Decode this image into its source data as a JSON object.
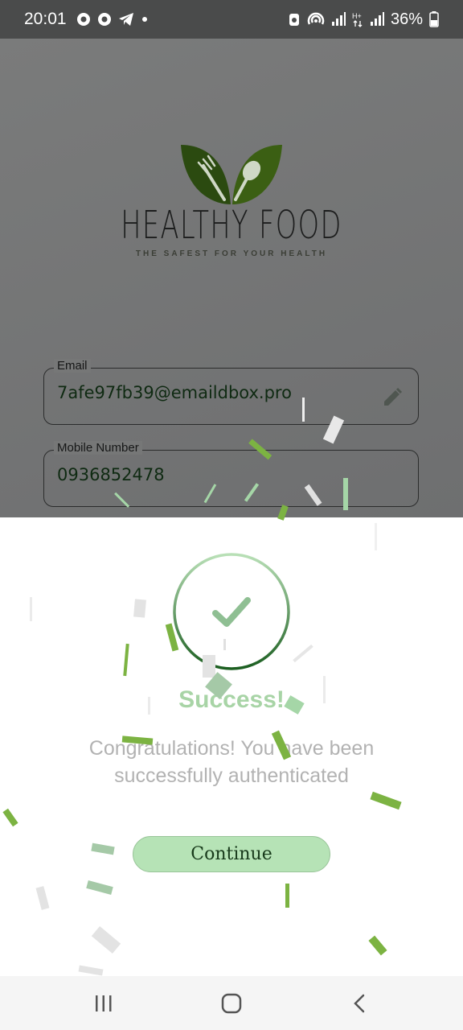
{
  "status_bar": {
    "time": "20:01",
    "battery": "36%",
    "icons_left": [
      "chrome-icon",
      "chrome-icon",
      "telegram-icon",
      "dot-icon"
    ],
    "icons_right": [
      "alarm-icon",
      "hotspot-icon",
      "signal-icon",
      "data-icon",
      "signal-icon",
      "battery-icon"
    ]
  },
  "brand": {
    "title": "HEALTHY FOOD",
    "tagline": "THE SAFEST FOR YOUR HEALTH"
  },
  "form": {
    "email": {
      "label": "Email",
      "value": "7afe97fb39@emaildbox.pro"
    },
    "mobile": {
      "label": "Mobile Number",
      "value": "0936852478"
    }
  },
  "dialog": {
    "title": "Success!",
    "message": "Congratulations! You have been successfully authenticated",
    "button": "Continue"
  },
  "colors": {
    "accent": "#b6e3b6",
    "dark_green": "#1b5e20",
    "confetti": [
      "#7cb342",
      "#a5d6a7",
      "#e0e0e0",
      "#8bc34a"
    ]
  }
}
